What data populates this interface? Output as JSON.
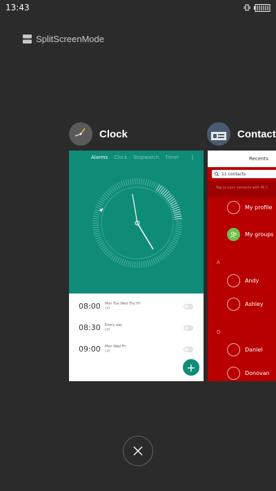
{
  "status_bar": {
    "time": "13:43"
  },
  "split_screen": {
    "label": "SplitScreenMode"
  },
  "apps": {
    "clock": {
      "title": "Clock",
      "tabs": [
        "Alarms",
        "Clock",
        "Stopwatch",
        "Timer"
      ],
      "alarms": [
        {
          "time": "08:00",
          "days": "Mon Tue Wed Thu Fri",
          "status": "Off"
        },
        {
          "time": "08:30",
          "days": "Every day",
          "status": "Off"
        },
        {
          "time": "09:00",
          "days": "Mon Wed Fri",
          "status": "Off"
        }
      ],
      "add_label": "+"
    },
    "contacts": {
      "title": "Contacts",
      "tab": "Recents",
      "search": "11 contacts",
      "sync_notice": "Tap to sync contacts with Mi C",
      "profile": "My profile",
      "groups": "My groups",
      "section_a": "A",
      "section_d": "D",
      "contacts_list": [
        "Andy",
        "Ashley",
        "Daniel",
        "Donovan"
      ]
    }
  },
  "colors": {
    "clock_accent": "#0e8c78",
    "contacts_accent": "#b80000",
    "background": "#2b2b2b"
  }
}
